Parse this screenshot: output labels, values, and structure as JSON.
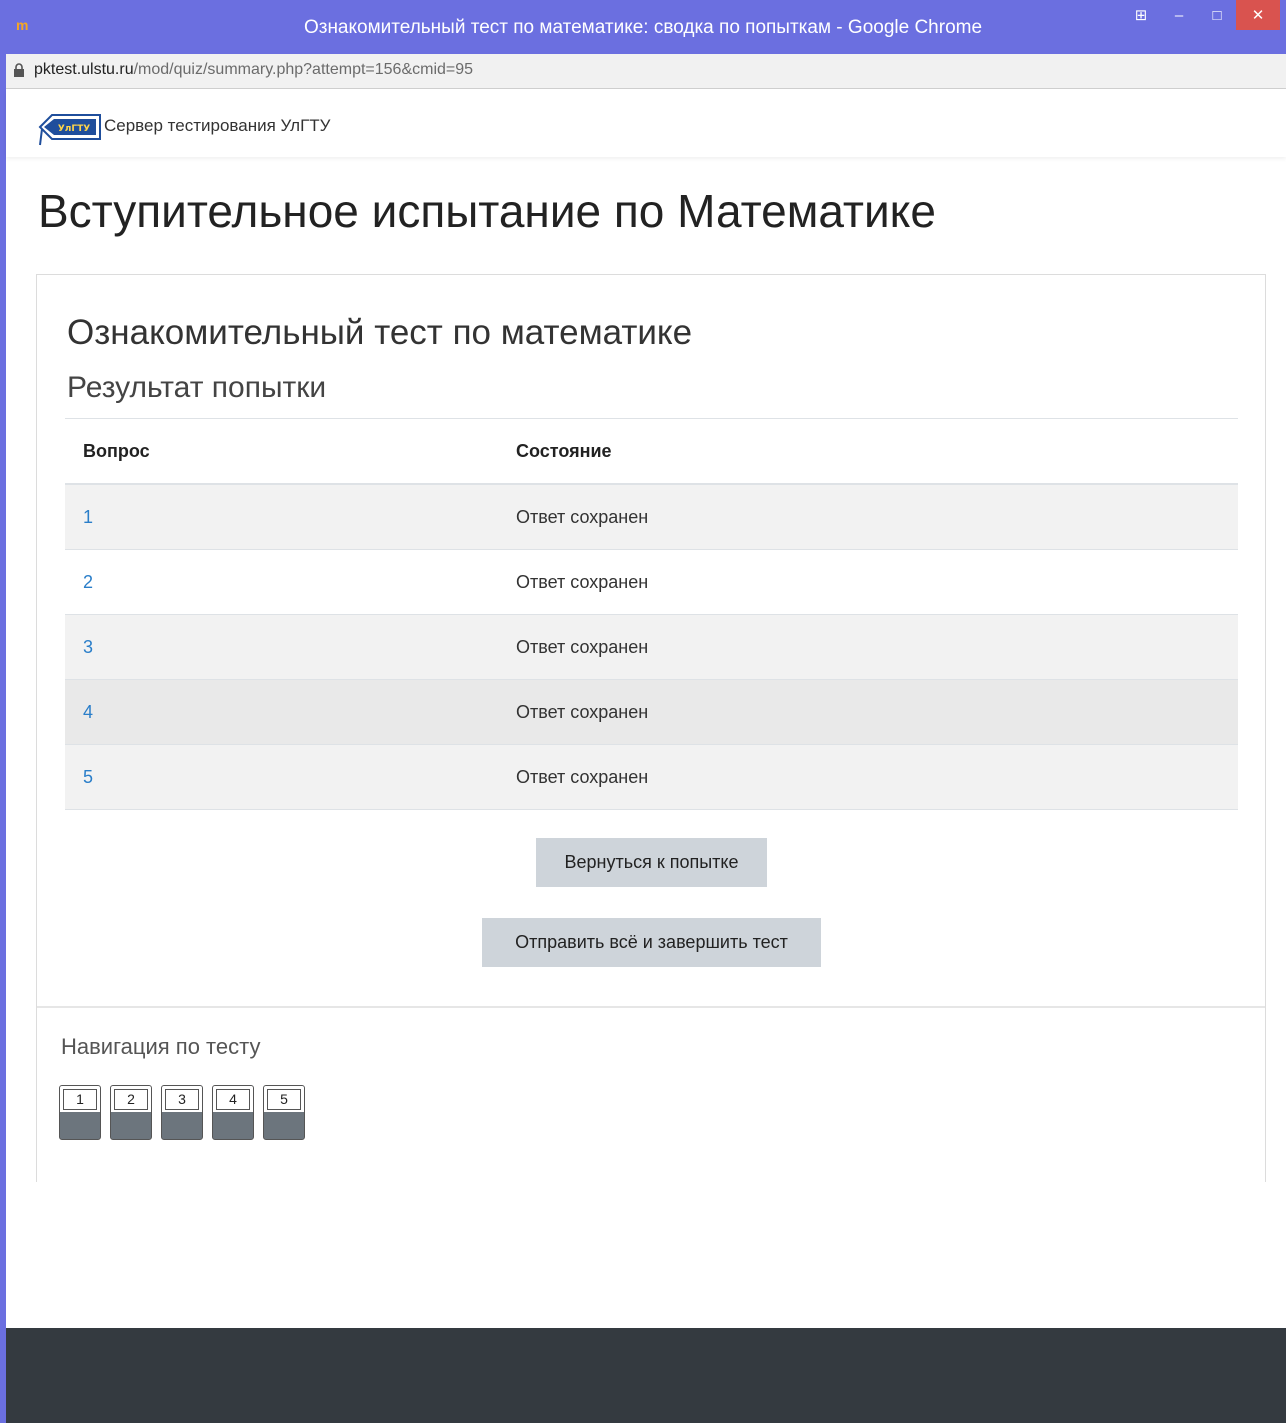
{
  "window": {
    "title": "Ознакомительный тест по математике: сводка по попыткам - Google Chrome",
    "app_icon_label": "m"
  },
  "address_bar": {
    "domain": "pktest.ulstu.ru",
    "path": "/mod/quiz/summary.php?attempt=156&cmid=95"
  },
  "navbar": {
    "brand": "Сервер тестирования УлГТУ",
    "logo_text": "УлГТУ"
  },
  "page": {
    "title": "Вступительное испытание по Математике",
    "quiz_name": "Ознакомительный тест по математике",
    "summary_heading": "Результат попытки"
  },
  "table": {
    "headers": {
      "question": "Вопрос",
      "status": "Состояние"
    },
    "rows": [
      {
        "question": "1",
        "status": "Ответ сохранен"
      },
      {
        "question": "2",
        "status": "Ответ сохранен"
      },
      {
        "question": "3",
        "status": "Ответ сохранен"
      },
      {
        "question": "4",
        "status": "Ответ сохранен"
      },
      {
        "question": "5",
        "status": "Ответ сохранен"
      }
    ]
  },
  "buttons": {
    "return": "Вернуться к попытке",
    "submit": "Отправить всё и завершить тест"
  },
  "quiz_navigation": {
    "title": "Навигация по тесту",
    "questions": [
      "1",
      "2",
      "3",
      "4",
      "5"
    ]
  },
  "colors": {
    "titlebar": "#6b6fe0",
    "link": "#2a7ec9",
    "button": "#ced4da",
    "footer": "#343a40",
    "close": "#d9534f"
  }
}
